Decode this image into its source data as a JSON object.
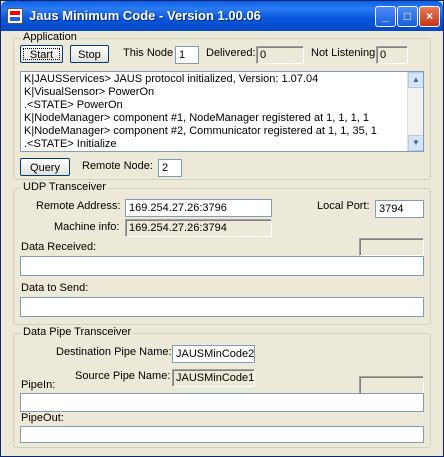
{
  "window": {
    "title": "Jaus Minimum Code - Version 1.00.06"
  },
  "titlebar_buttons": {
    "minimize": "_",
    "maximize": "□",
    "close": "×"
  },
  "application": {
    "legend": "Application",
    "start_label": "Start",
    "stop_label": "Stop",
    "this_node_label": "This Node",
    "this_node_value": "1",
    "delivered_label": "Delivered:",
    "delivered_value": "0",
    "not_listening_label": "Not Listening:",
    "not_listening_value": "0",
    "log": [
      "K|JAUSServices> JAUS protocol initialized, Version: 1.07.04",
      "K|VisualSensor> PowerOn",
      ".<STATE> PowerOn",
      "K|NodeManager> component #1, NodeManager registered at 1, 1, 1, 1",
      "K|NodeManager> component #2, Communicator registered at 1, 1, 35, 1",
      ".<STATE> Initialize"
    ],
    "query_label": "Query",
    "remote_node_label": "Remote Node:",
    "remote_node_value": "2"
  },
  "udp": {
    "legend": "UDP Transceiver",
    "remote_address_label": "Remote Address:",
    "remote_address_value": "169.254.27.26:3796",
    "local_port_label": "Local Port:",
    "local_port_value": "3794",
    "machine_info_label": "Machine info:",
    "machine_info_value": "169.254.27.26:3794",
    "data_received_label": "Data Received:",
    "data_received_value": "",
    "data_to_send_label": "Data to Send:",
    "data_to_send_value": ""
  },
  "pipe": {
    "legend": "Data Pipe Transceiver",
    "destination_label": "Destination Pipe Name:",
    "destination_value": "JAUSMinCode2",
    "source_label": "Source Pipe Name:",
    "source_value": "JAUSMinCode1",
    "pipe_in_label": "PipeIn:",
    "pipe_in_value": "",
    "pipe_out_label": "PipeOut:",
    "pipe_out_value": ""
  }
}
